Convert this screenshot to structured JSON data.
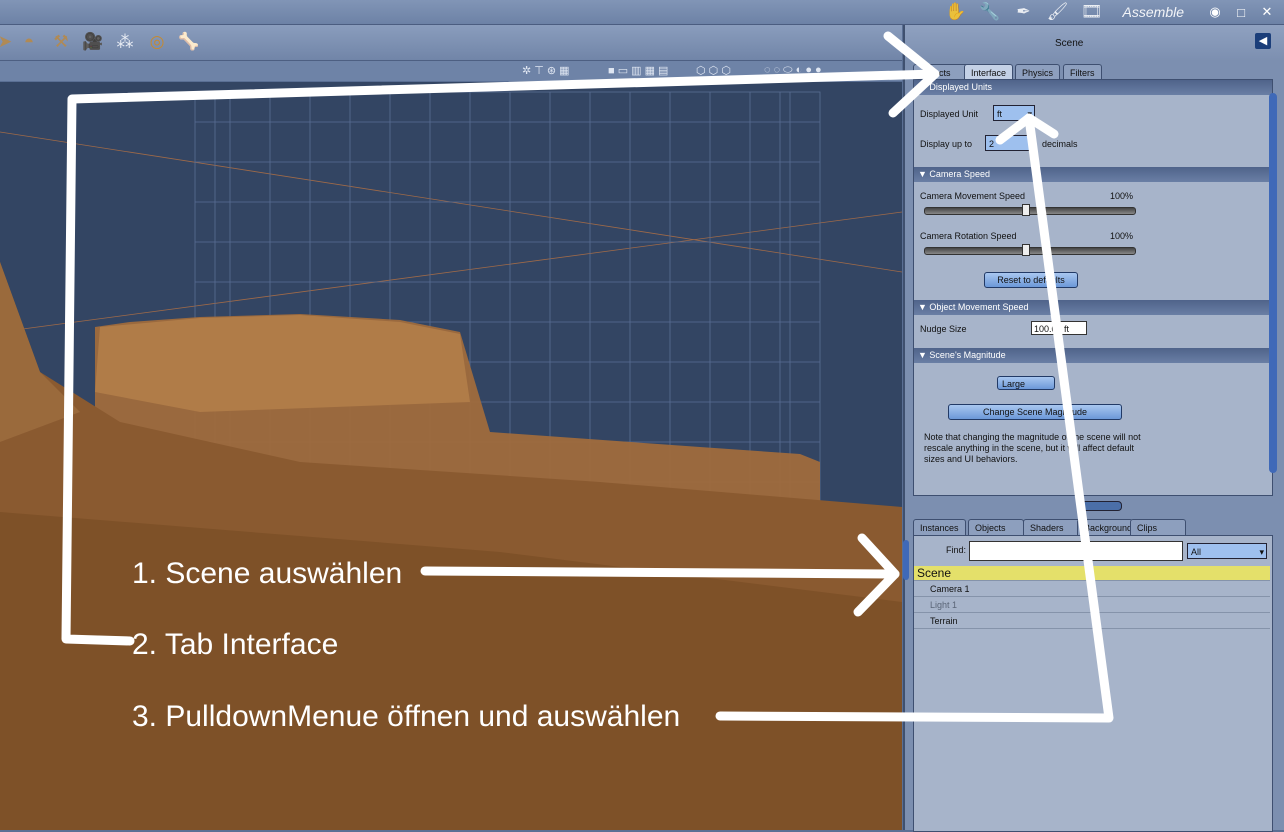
{
  "titlebar": {
    "room_icons": [
      "hand-icon",
      "wrench-icon",
      "pen-icon",
      "brush-icon",
      "film-icon"
    ],
    "room_label": "Assemble",
    "window_buttons": [
      "eye-icon",
      "maximize-icon",
      "close-icon"
    ]
  },
  "toolbar": {
    "tools": [
      "arrow-icon",
      "bowl-icon",
      "hammer-icon",
      "camera-icon",
      "light-icon",
      "target-icon",
      "bone-icon"
    ]
  },
  "panel": {
    "title": "Scene",
    "tabs": [
      "Objects",
      "Interface",
      "Physics",
      "Filters"
    ],
    "active_tab": "Interface",
    "sections": {
      "displayed_units": {
        "header": "Displayed Units",
        "unit_label": "Displayed Unit",
        "unit_value": "ft",
        "decimals_label": "Display up to",
        "decimals_value": "2",
        "decimals_suffix": "decimals"
      },
      "camera_speed": {
        "header": "Camera Speed",
        "movement_label": "Camera Movement Speed",
        "movement_value": "100%",
        "rotation_label": "Camera Rotation Speed",
        "rotation_value": "100%",
        "reset_label": "Reset to defaults"
      },
      "object_movement": {
        "header": "Object Movement Speed",
        "nudge_label": "Nudge Size",
        "nudge_value": "100.00 ft"
      },
      "magnitude": {
        "header": "Scene's Magnitude",
        "value": "Large",
        "change_label": "Change Scene Magnitude",
        "note": "Note that changing the magnitude of the scene will not rescale anything in the scene, but it will affect default sizes and UI behaviors."
      }
    }
  },
  "browser": {
    "tabs": [
      "Instances",
      "Objects",
      "Shaders",
      "Backgrounds",
      "Clips"
    ],
    "active_tab": "Instances",
    "find_label": "Find:",
    "find_value": "",
    "filter_value": "All",
    "rows": [
      {
        "name": "Scene",
        "selected": true
      },
      {
        "name": "Camera 1",
        "selected": false
      },
      {
        "name": "Light 1",
        "selected": false,
        "dimmed": true
      },
      {
        "name": "Terrain",
        "selected": false
      }
    ]
  },
  "annotations": {
    "step1": "1. Scene auswählen",
    "step2": "2. Tab Interface",
    "step3": "3. PulldownMenue öffnen und auswählen"
  },
  "colors": {
    "viewport_sky": "#334563",
    "terrain": "#8a5a30",
    "panel_bg": "#7c8fb0",
    "selected_row": "#e4e06a"
  }
}
